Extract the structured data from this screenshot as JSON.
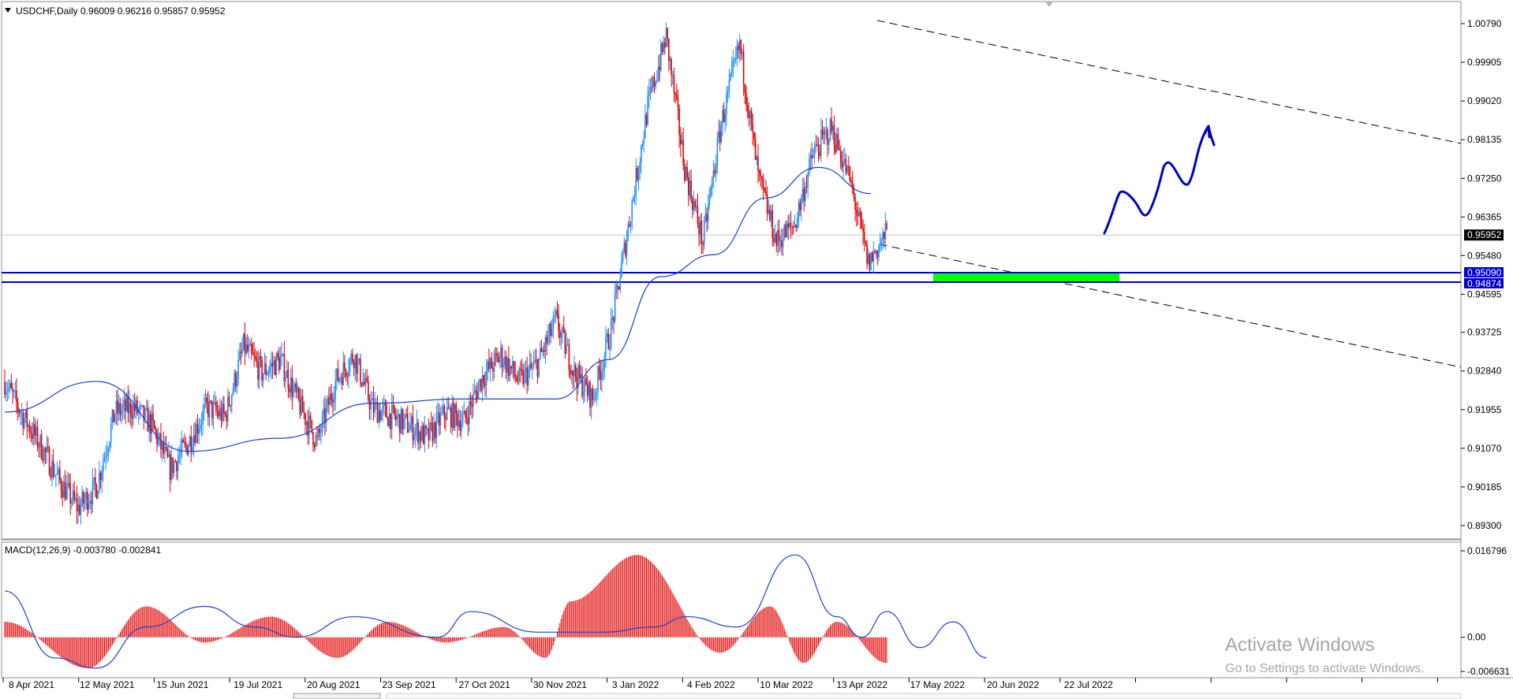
{
  "symbol_header": "USDCHF,Daily  0.96009 0.96216 0.95857 0.95952",
  "macd_header": "MACD(12,26,9) -0.003780 -0.002841",
  "price_axis": [
    "1.00790",
    "0.99905",
    "0.99020",
    "0.98135",
    "0.97250",
    "0.96365",
    "0.95480",
    "0.94595",
    "0.93725",
    "0.92840",
    "0.91955",
    "0.91070",
    "0.90185",
    "0.89300"
  ],
  "price_axis_values": [
    1.0079,
    0.99905,
    0.9902,
    0.98135,
    0.9725,
    0.96365,
    0.9548,
    0.94595,
    0.93725,
    0.9284,
    0.91955,
    0.9107,
    0.90185,
    0.893
  ],
  "macd_axis": [
    "0.016796",
    "0.00",
    "-0.006631"
  ],
  "macd_axis_values": [
    0.016796,
    0.0,
    -0.006631
  ],
  "current_price_label": "0.95952",
  "current_price": 0.95952,
  "level_upper_label": "0.95090",
  "level_upper": 0.9509,
  "level_lower_label": "0.94874",
  "level_lower": 0.94874,
  "date_axis": [
    "8 Apr 2021",
    "12 May 2021",
    "15 Jun 2021",
    "19 Jul 2021",
    "20 Aug 2021",
    "23 Sep 2021",
    "27 Oct 2021",
    "30 Nov 2021",
    "3 Jan 2022",
    "4 Feb 2022",
    "10 Mar 2022",
    "13 Apr 2022",
    "17 May 2022",
    "20 Jun 2022",
    "22 Jul 2022"
  ],
  "watermark_title": "Activate Windows",
  "watermark_sub": "Go to Settings to activate Windows.",
  "colors": {
    "bull": "#1e90ff",
    "bear": "#e00000",
    "ma_line": "#1f3fcf",
    "level_line": "#0000cc",
    "zone": "#00ff00",
    "drawing": "#0000cc",
    "macd_hist": "#e00000",
    "macd_signal": "#1f3fcf",
    "trend_line": "#000000"
  },
  "chart_data": {
    "type": "candlestick",
    "title": "USDCHF,Daily",
    "ohlc_last": {
      "open": 0.96009,
      "high": 0.96216,
      "low": 0.95857,
      "close": 0.95952
    },
    "ylim": [
      0.893,
      1.0079
    ],
    "close_path": [
      [
        0,
        0.926
      ],
      [
        14,
        0.918
      ],
      [
        28,
        0.911
      ],
      [
        42,
        0.903
      ],
      [
        56,
        0.897
      ],
      [
        70,
        0.902
      ],
      [
        84,
        0.919
      ],
      [
        98,
        0.92
      ],
      [
        112,
        0.916
      ],
      [
        126,
        0.906
      ],
      [
        140,
        0.912
      ],
      [
        154,
        0.92
      ],
      [
        168,
        0.918
      ],
      [
        182,
        0.934
      ],
      [
        196,
        0.928
      ],
      [
        210,
        0.931
      ],
      [
        224,
        0.921
      ],
      [
        238,
        0.912
      ],
      [
        252,
        0.926
      ],
      [
        266,
        0.932
      ],
      [
        280,
        0.92
      ],
      [
        294,
        0.918
      ],
      [
        308,
        0.916
      ],
      [
        322,
        0.913
      ],
      [
        336,
        0.919
      ],
      [
        350,
        0.917
      ],
      [
        364,
        0.927
      ],
      [
        378,
        0.932
      ],
      [
        392,
        0.926
      ],
      [
        406,
        0.93
      ],
      [
        420,
        0.94
      ],
      [
        434,
        0.928
      ],
      [
        448,
        0.922
      ],
      [
        462,
        0.938
      ],
      [
        476,
        0.963
      ],
      [
        490,
        0.989
      ],
      [
        504,
        1.005
      ],
      [
        518,
        0.975
      ],
      [
        532,
        0.958
      ],
      [
        546,
        0.985
      ],
      [
        560,
        1.003
      ],
      [
        574,
        0.973
      ],
      [
        588,
        0.958
      ],
      [
        602,
        0.962
      ],
      [
        616,
        0.978
      ],
      [
        630,
        0.984
      ],
      [
        644,
        0.972
      ],
      [
        658,
        0.953
      ],
      [
        672,
        0.96
      ]
    ],
    "moving_average": [
      [
        0,
        0.919
      ],
      [
        70,
        0.926
      ],
      [
        140,
        0.91
      ],
      [
        210,
        0.913
      ],
      [
        280,
        0.921
      ],
      [
        350,
        0.922
      ],
      [
        420,
        0.922
      ],
      [
        460,
        0.931
      ],
      [
        500,
        0.95
      ],
      [
        540,
        0.955
      ],
      [
        580,
        0.968
      ],
      [
        620,
        0.975
      ],
      [
        660,
        0.969
      ]
    ],
    "macd_histogram_path": [
      [
        0,
        0.003
      ],
      [
        100,
        -0.006
      ],
      [
        170,
        0.006
      ],
      [
        240,
        -0.001
      ],
      [
        320,
        0.004
      ],
      [
        400,
        -0.004
      ],
      [
        460,
        0.003
      ],
      [
        530,
        -0.001
      ],
      [
        600,
        0.002
      ],
      [
        650,
        -0.004
      ],
      [
        680,
        0.007
      ],
      [
        760,
        0.016
      ],
      [
        860,
        -0.003
      ],
      [
        920,
        0.006
      ],
      [
        960,
        -0.005
      ],
      [
        1000,
        0.003
      ],
      [
        1060,
        -0.005
      ]
    ],
    "macd_signal_path": [
      [
        0,
        0.009
      ],
      [
        60,
        -0.004
      ],
      [
        110,
        -0.006
      ],
      [
        170,
        0.002
      ],
      [
        240,
        0.006
      ],
      [
        300,
        0.002
      ],
      [
        350,
        0.0
      ],
      [
        420,
        0.004
      ],
      [
        520,
        0.0
      ],
      [
        560,
        0.005
      ],
      [
        640,
        0.001
      ],
      [
        720,
        0.001
      ],
      [
        780,
        0.002
      ],
      [
        820,
        0.004
      ],
      [
        880,
        0.002
      ],
      [
        950,
        0.016
      ],
      [
        1000,
        0.004
      ],
      [
        1030,
        0.0
      ],
      [
        1060,
        0.005
      ],
      [
        1100,
        -0.002
      ],
      [
        1140,
        0.003
      ],
      [
        1180,
        -0.004
      ]
    ],
    "support_zone": [
      0.94874,
      0.9509
    ]
  }
}
